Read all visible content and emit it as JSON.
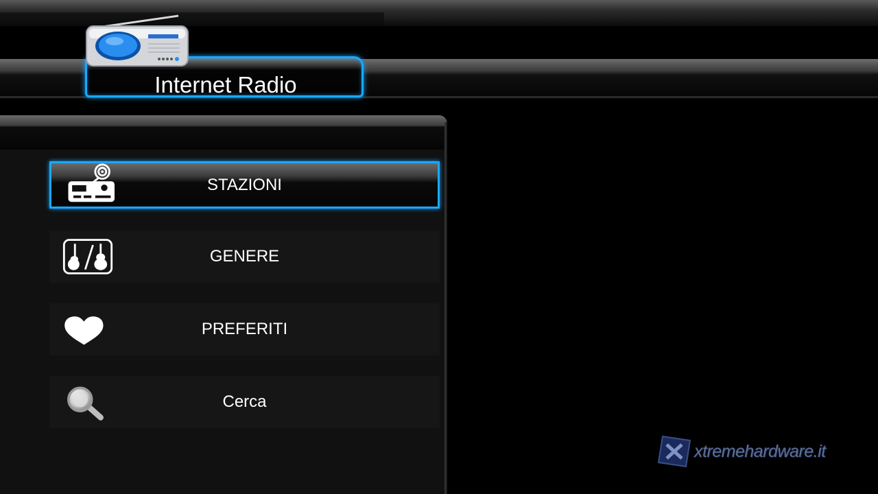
{
  "header": {
    "title": "Internet Radio",
    "icon": "radio-icon"
  },
  "menu": {
    "items": [
      {
        "label": "STAZIONI",
        "icon": "radio-tower-icon",
        "selected": true
      },
      {
        "label": "GENERE",
        "icon": "guitar-violin-icon",
        "selected": false
      },
      {
        "label": "PREFERITI",
        "icon": "heart-icon",
        "selected": false
      },
      {
        "label": "Cerca",
        "icon": "magnifier-icon",
        "selected": false
      }
    ]
  },
  "watermark": {
    "text": "xtremehardware.it",
    "icon": "x-logo-icon"
  },
  "colors": {
    "accent": "#19a9ff",
    "background": "#000000",
    "panel": "#111111",
    "text": "#ffffff"
  }
}
